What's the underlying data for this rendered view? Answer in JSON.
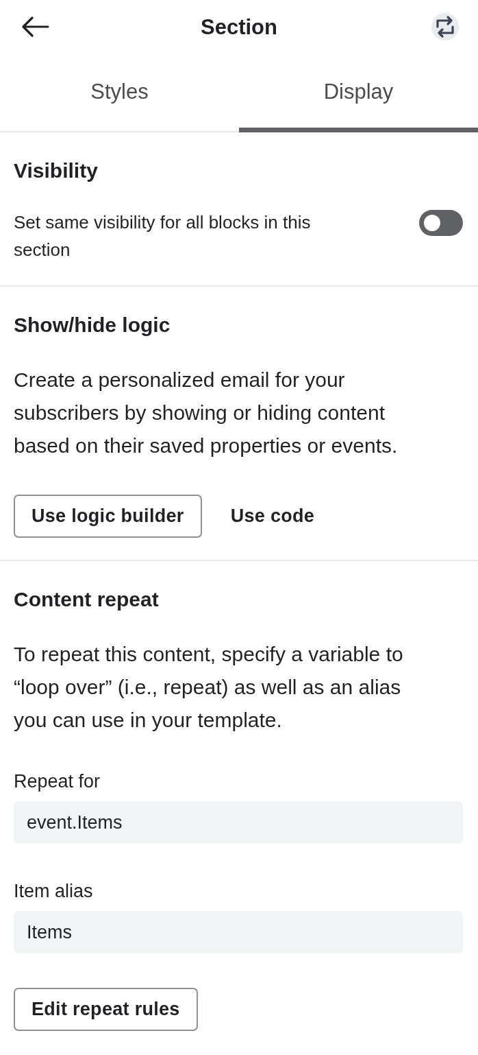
{
  "header": {
    "title": "Section"
  },
  "tabs": [
    {
      "label": "Styles",
      "selected": false
    },
    {
      "label": "Display",
      "selected": true
    }
  ],
  "sections": [
    {
      "title": "Visibility",
      "toggle": {
        "label": "Set same visibility for all blocks in this section",
        "on": false
      }
    },
    {
      "title": "Show/hide logic",
      "description": "Create a personalized email for your subscribers by showing or hiding content based on their saved properties or events.",
      "buttons": [
        {
          "label": "Use logic builder",
          "kind": "outlined"
        },
        {
          "label": "Use code",
          "kind": "text"
        }
      ]
    },
    {
      "title": "Content repeat",
      "description": "To repeat this content, specify a variable to “loop over” (i.e., repeat) as well as an alias you can use in your template.",
      "fields": [
        {
          "label": "Repeat for",
          "value": "event.Items"
        },
        {
          "label": "Item alias",
          "value": "Items"
        }
      ],
      "buttons": [
        {
          "label": "Edit repeat rules",
          "kind": "outlined"
        }
      ]
    }
  ]
}
